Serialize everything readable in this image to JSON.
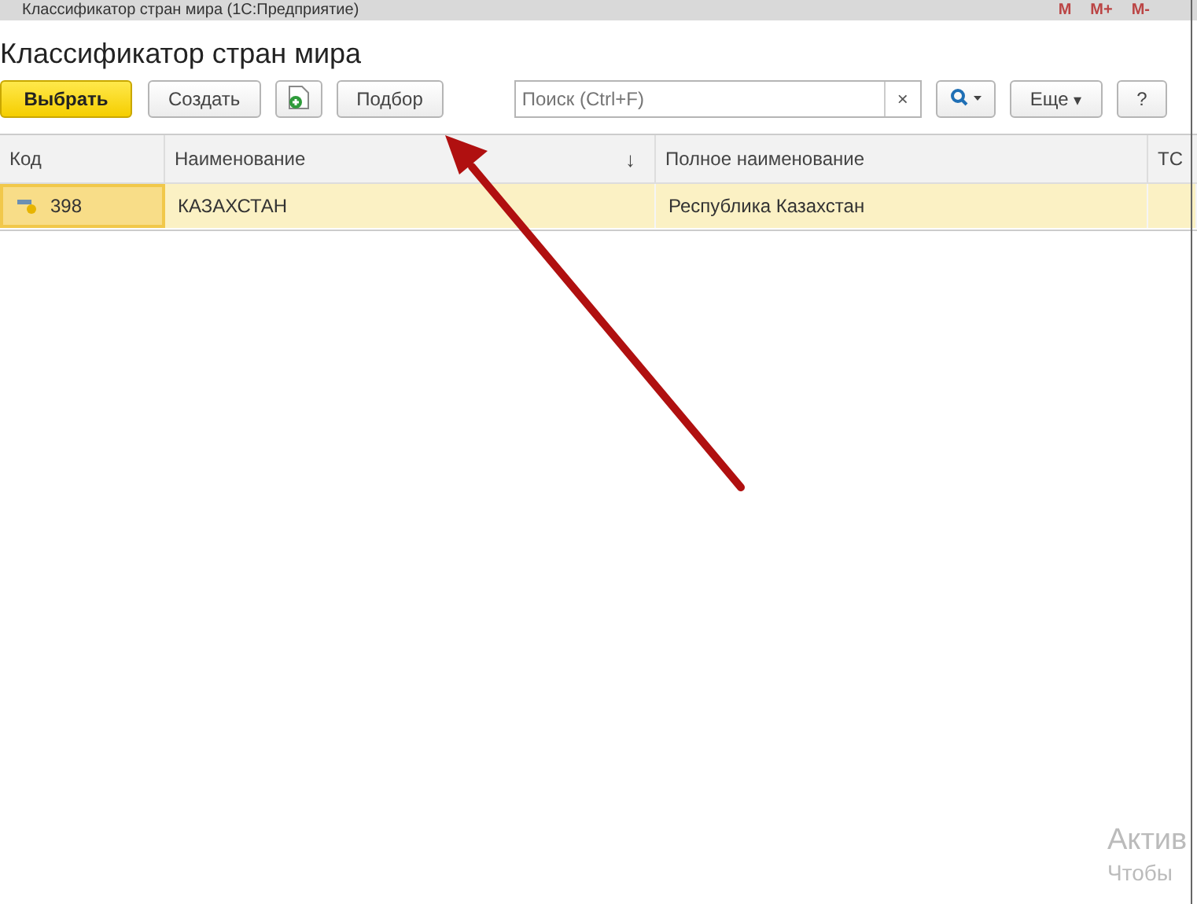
{
  "window": {
    "title": "Классификатор стран мира  (1С:Предприятие)",
    "title_buttons": [
      "M",
      "M+",
      "M-"
    ]
  },
  "heading": "Классификатор стран мира",
  "toolbar": {
    "select_button": "Выбрать",
    "create_button": "Создать",
    "pick_button": "Подбор",
    "search": {
      "placeholder": "Поиск (Ctrl+F)",
      "clear": "×"
    },
    "more_button": "Еще",
    "more_caret": "▾",
    "help_button": "?"
  },
  "table": {
    "columns": [
      {
        "label": "Код"
      },
      {
        "label": "Наименование",
        "sort": "↓"
      },
      {
        "label": "Полное наименование"
      },
      {
        "label": "ТС"
      }
    ],
    "rows": [
      {
        "selected": true,
        "cells": [
          "398",
          "КАЗАХСТАН",
          "Республика Казахстан",
          ""
        ]
      }
    ]
  },
  "activation_notice": [
    "Актив",
    "Чтобы"
  ]
}
